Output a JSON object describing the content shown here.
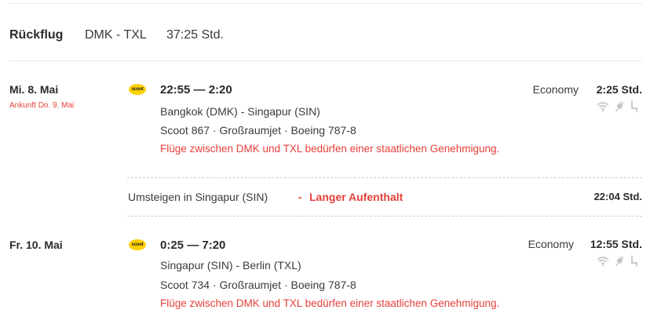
{
  "header": {
    "title": "Rückflug",
    "route": "DMK - TXL",
    "duration": "37:25 Std."
  },
  "segments": [
    {
      "date": "Mi. 8. Mai",
      "arrival_note": "Ankunft Do. 9. Mai",
      "airline_logo": "scoot",
      "times": "22:55 — 2:20",
      "route": "Bangkok (DMK) - Singapur (SIN)",
      "flight_info": "Scoot 867 · Großraumjet · Boeing 787-8",
      "warning": "Flüge zwischen DMK und TXL bedürfen einer staatlichen Genehmigung.",
      "cabin": "Economy",
      "duration": "2:25 Std.",
      "amenity_icons": [
        "wifi-icon",
        "power-plug-icon",
        "seat-icon"
      ]
    },
    {
      "date": "Fr. 10. Mai",
      "arrival_note": "",
      "airline_logo": "scoot",
      "times": "0:25 — 7:20",
      "route": "Singapur (SIN) - Berlin (TXL)",
      "flight_info": "Scoot 734 · Großraumjet · Boeing 787-8",
      "warning": "Flüge zwischen DMK und TXL bedürfen einer staatlichen Genehmigung.",
      "cabin": "Economy",
      "duration": "12:55 Std.",
      "amenity_icons": [
        "wifi-icon",
        "power-plug-icon",
        "seat-icon"
      ]
    }
  ],
  "layover": {
    "text": "Umsteigen in Singapur (SIN)",
    "separator": "-",
    "flag": "Langer Aufenthalt",
    "duration": "22:04 Std."
  },
  "colors": {
    "warning": "#e5403a",
    "logo_yellow": "#ffd000",
    "icon_gray": "#c4c4c4"
  }
}
